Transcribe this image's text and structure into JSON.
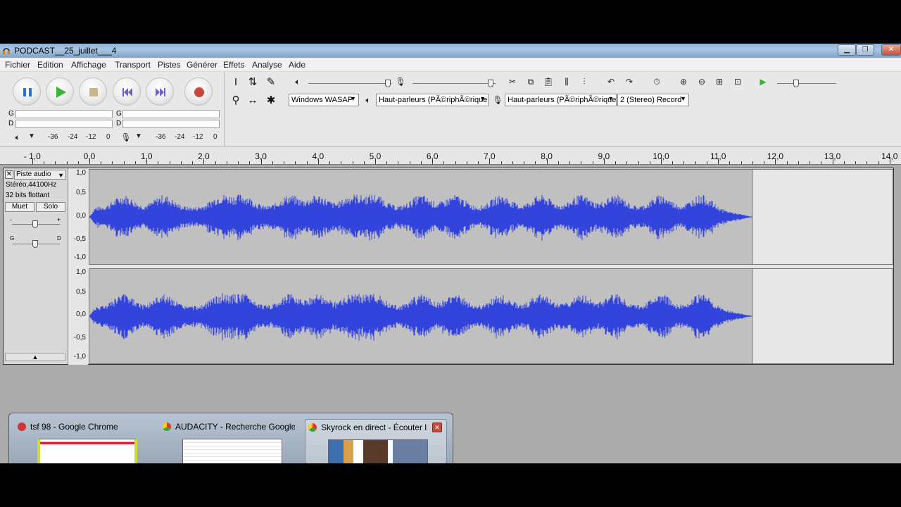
{
  "window": {
    "title": "PODCAST__25_juillet___4"
  },
  "menu": [
    "Fichier",
    "Edition",
    "Affichage",
    "Transport",
    "Pistes",
    "Générer",
    "Effets",
    "Analyse",
    "Aide"
  ],
  "meters": {
    "left_label": "G",
    "right_label": "D",
    "scale": [
      "-36",
      "-24",
      "-12",
      "0"
    ]
  },
  "device": {
    "host": "Windows WASAP",
    "output": "Haut-parleurs (PÃ©riphÃ©rique",
    "input": "Haut-parleurs (PÃ©riphÃ©rique",
    "channels": "2 (Stereo) Record"
  },
  "ruler": [
    "- 1,0",
    "0,0",
    "1,0",
    "2,0",
    "3,0",
    "4,0",
    "5,0",
    "6,0",
    "7,0",
    "8,0",
    "9,0",
    "10,0",
    "11,0",
    "12,0",
    "13,0",
    "14,0"
  ],
  "track": {
    "name": "Piste audio",
    "format": "Stéréo,44100Hz",
    "bits": "32 bits flottant",
    "mute_label": "Muet",
    "solo_label": "Solo",
    "gain_left": "-",
    "gain_right": "+",
    "pan_left": "G",
    "pan_right": "D",
    "scale": [
      "1,0",
      "0,5",
      "0,0",
      "-0,5",
      "-1,0"
    ],
    "audio_end_seconds": 11.6,
    "waveform_color": "#3344dd"
  },
  "taskbar_thumbs": [
    {
      "title": "tsf 98 - Google Chrome"
    },
    {
      "title": "AUDACITY - Recherche Google ..."
    },
    {
      "title": "Skyrock en direct - Écouter l..."
    }
  ]
}
